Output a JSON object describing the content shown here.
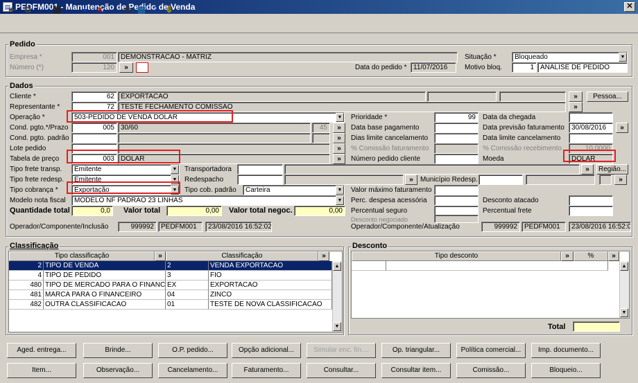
{
  "window": {
    "title": "PEDFM001 - Manutenção de Pedido de Venda"
  },
  "toolbar": {
    "add": "+",
    "delete": "×",
    "help": "?"
  },
  "pedido": {
    "group_title": "Pedido",
    "empresa_label": "Empresa *",
    "empresa_code": "001",
    "empresa_name": "DEMONSTRACAO - MATRIZ",
    "numero_label": "Número (*)",
    "numero_value": "120",
    "numero_btn": "»",
    "situacao_label": "Situação *",
    "situacao_value": "Bloqueado",
    "data_label": "Data do pedido *",
    "data_value": "11/07/2016",
    "motivo_label": "Motivo bloq.",
    "motivo_code": "1",
    "motivo_desc": "ANALISE DE PEDIDO"
  },
  "dados": {
    "group_title": "Dados",
    "cliente_label": "Cliente *",
    "cliente_code": "62",
    "cliente_name": "EXPORTACAO",
    "pessoa_btn": "Pessoa...",
    "representante_label": "Representante *",
    "representante_code": "72",
    "representante_name": "TESTE FECHAMENTO COMISSAO",
    "operacao_label": "Operação *",
    "operacao_value": "503-PEDIDO DE VENDA DOLAR",
    "condpgto_label": "Cond. pgto.*/Prazo",
    "condpgto_code": "005",
    "condpgto_prazo": "30/60",
    "condpgto_num": "45",
    "condpadrao_label": "Cond. pgto. padrão",
    "lote_label": "Lote pedido",
    "tabela_label": "Tabela de preço",
    "tabela_code": "003",
    "tabela_name": "DOLAR",
    "freteTransp_label": "Tipo frete transp.",
    "freteTransp_value": "Emitente",
    "freteRedesp_label": "Tipo frete redesp.",
    "freteRedesp_value": "Emitente",
    "cobranca_label": "Tipo cobrança *",
    "cobranca_value": "Exportação",
    "modelo_label": "Modelo nota fiscal",
    "modelo_value": "MODELO NF PADRAO 23 LINHAS",
    "transportadora_label": "Transportadora",
    "redespacho_label": "Redespacho",
    "municipio_label": "Município Redesp.",
    "regiao_btn": "Região...",
    "cobpadrao_label": "Tipo cob. padrão",
    "cobpadrao_value": "Carteira",
    "qtd_label": "Quantidade total",
    "qtd_value": "0,0",
    "valortotal_label": "Valor total",
    "valortotal_value": "0,00",
    "valorneg_label": "Valor total negoc.",
    "valorneg_value": "0,00",
    "prioridade_label": "Prioridade *",
    "prioridade_value": "99",
    "database_label": "Data base pagamento",
    "diaslimite_label": "Dias limite cancelamento",
    "comissaofat_label": "% Comissão faturamento",
    "numcliente_label": "Número pedido cliente",
    "chegada_label": "Data da chegada",
    "previsao_label": "Data previsão faturamento",
    "previsao_value": "30/08/2016",
    "datalimite_label": "Data limite cancelamento",
    "comissaorec_label": "% Comissão recebimento",
    "comissaorec_value": "10,0000",
    "moeda_label": "Moeda",
    "moeda_value": "DOLAR",
    "valormax_label": "Valor máximo faturamento",
    "percdespesa_label": "Perc. despesa acessória",
    "percseguro_label": "Percentual seguro",
    "descneg_label": "Desconto negociado",
    "descatacado_label": "Desconto atacado",
    "percfrete_label": "Percentual frete",
    "opinc_label": "Operador/Componente/Inclusão",
    "opinc_code": "999992",
    "opinc_comp": "PEDFM001",
    "opinc_date": "23/08/2016 16:52:02",
    "opatu_label": "Operador/Componente/Atualização",
    "opatu_code": "999992",
    "opatu_comp": "PEDFM001",
    "opatu_date": "23/08/2016 16:52:0"
  },
  "classificacao": {
    "group_title": "Classificação",
    "col_tipo": "Tipo classificação",
    "col_class": "Classificação",
    "rows": [
      {
        "code": "2",
        "tipo": "TIPO DE VENDA",
        "c2": "2",
        "class": "VENDA EXPORTACAO"
      },
      {
        "code": "4",
        "tipo": "TIPO DE PEDIDO",
        "c2": "3",
        "class": "FIO"
      },
      {
        "code": "480",
        "tipo": "TIPO DE MERCADO PARA O FINANCEIRO",
        "c2": "EX",
        "class": "EXPORTACAO"
      },
      {
        "code": "481",
        "tipo": "MARCA PARA O FINANCEIRO",
        "c2": "04",
        "class": "ZINCO"
      },
      {
        "code": "482",
        "tipo": "OUTRA CLASSIFICACAO",
        "c2": "01",
        "class": "TESTE DE NOVA CLASSIFICACAO"
      }
    ]
  },
  "desconto": {
    "group_title": "Desconto",
    "col_tipo": "Tipo desconto",
    "col_pct": "%",
    "total_label": "Total"
  },
  "buttons_row1": [
    "Aged. entrega...",
    "Brinde...",
    "O.P. pedido...",
    "Opção adicional...",
    "Simular enc. fin....",
    "Op. triangular...",
    "Política comercial...",
    "Imp. documento..."
  ],
  "buttons_row2": [
    "Item...",
    "Observação...",
    "Cancelamento...",
    "Faturamento...",
    "Consultar...",
    "Consultar item...",
    "Comissão...",
    "Bloqueio..."
  ],
  "arrow": "»"
}
